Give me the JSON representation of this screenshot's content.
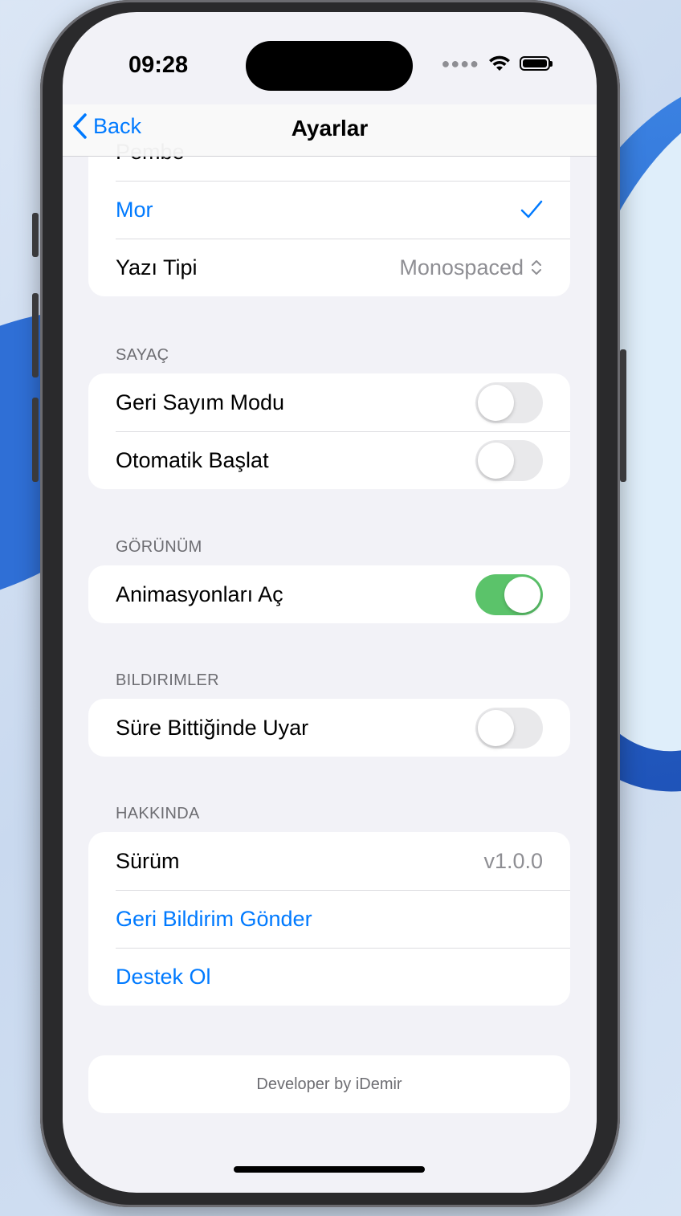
{
  "status": {
    "time": "09:28"
  },
  "nav": {
    "back_label": "Back",
    "title": "Ayarlar"
  },
  "theme_group": {
    "items": [
      {
        "label": "Pembe"
      },
      {
        "label": "Mor",
        "selected": true
      }
    ]
  },
  "font_row": {
    "label": "Yazı Tipi",
    "value": "Monospaced"
  },
  "timer_section": {
    "header": "SAYAÇ",
    "items": [
      {
        "label": "Geri Sayım Modu",
        "on": false
      },
      {
        "label": "Otomatik Başlat",
        "on": false
      }
    ]
  },
  "appearance_section": {
    "header": "GÖRÜNÜM",
    "items": [
      {
        "label": "Animasyonları Aç",
        "on": true
      }
    ]
  },
  "notifications_section": {
    "header": "BILDIRIMLER",
    "items": [
      {
        "label": "Süre Bittiğinde Uyar",
        "on": false
      }
    ]
  },
  "about_section": {
    "header": "HAKKINDA",
    "version_label": "Sürüm",
    "version_value": "v1.0.0",
    "feedback_label": "Geri Bildirim Gönder",
    "support_label": "Destek Ol"
  },
  "footer": {
    "text": "Developer by iDemir"
  },
  "colors": {
    "accent": "#007aff",
    "toggle_on": "#5bc36a",
    "background": "#f2f2f7"
  }
}
